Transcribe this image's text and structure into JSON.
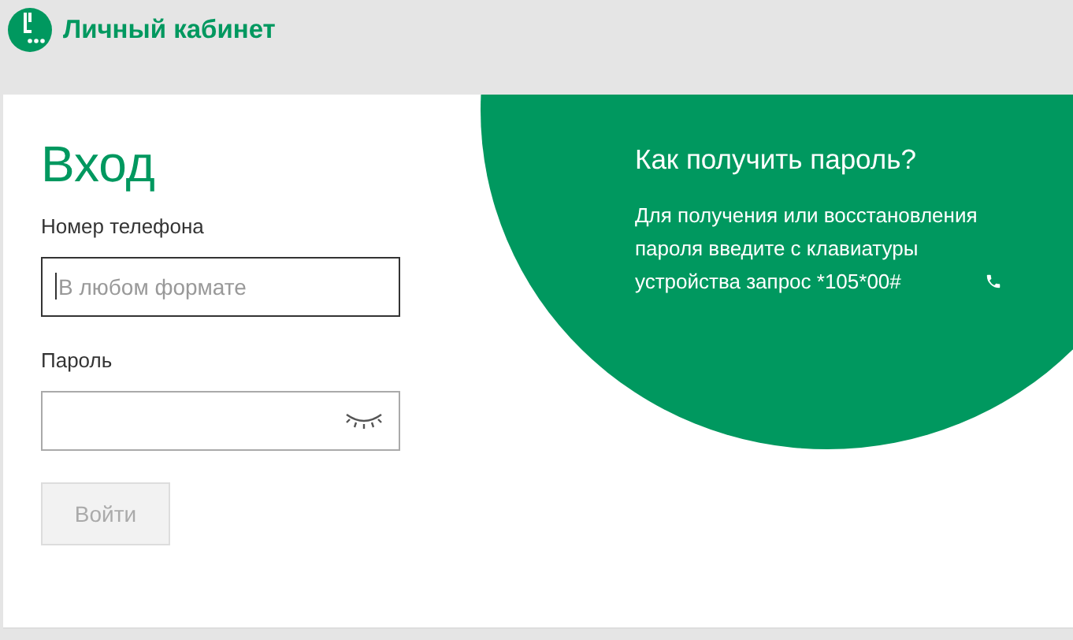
{
  "header": {
    "title": "Личный кабинет"
  },
  "login": {
    "title": "Вход",
    "fields": [
      {
        "label": "Номер телефона",
        "placeholder": "В любом формате",
        "focused": true,
        "kind": "text"
      },
      {
        "label": "Пароль",
        "focused": false,
        "kind": "password"
      }
    ],
    "submit": {
      "label": "Войти",
      "disabled": true
    }
  },
  "help": {
    "title": "Как получить пароль?",
    "text": "Для получения или восстановления пароля введите с клавиатуры устройства запрос *105*00#"
  }
}
